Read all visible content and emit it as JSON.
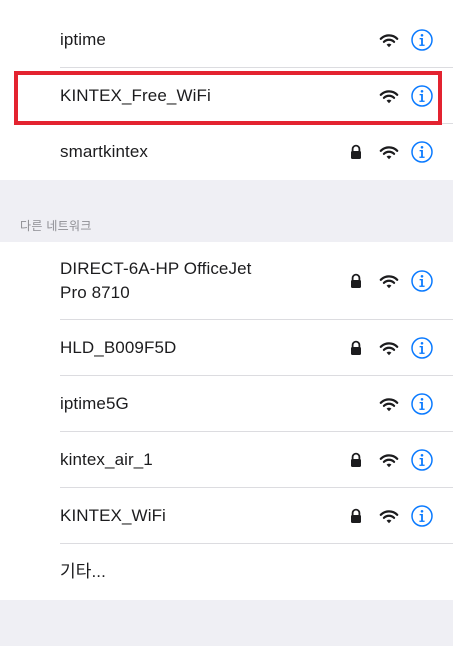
{
  "saved_networks": [
    {
      "name": "iptime",
      "locked": false
    },
    {
      "name": "KINTEX_Free_WiFi",
      "locked": false,
      "highlighted": true
    },
    {
      "name": "smartkintex",
      "locked": true
    }
  ],
  "other_networks_header": "다른 네트워크",
  "other_networks": [
    {
      "name_line1": "DIRECT-6A-HP OfficeJet",
      "name_line2": "Pro 8710",
      "locked": true
    },
    {
      "name": "HLD_B009F5D",
      "locked": true
    },
    {
      "name": "iptime5G",
      "locked": false
    },
    {
      "name": "kintex_air_1",
      "locked": true
    },
    {
      "name": "KINTEX_WiFi",
      "locked": true
    }
  ],
  "other_option": "기타...",
  "colors": {
    "accent": "#0a7aff",
    "highlight_border": "#e32330",
    "background": "#efeff4"
  },
  "icons": {
    "wifi": "wifi-icon",
    "lock": "lock-icon",
    "info": "info-circle-icon"
  }
}
